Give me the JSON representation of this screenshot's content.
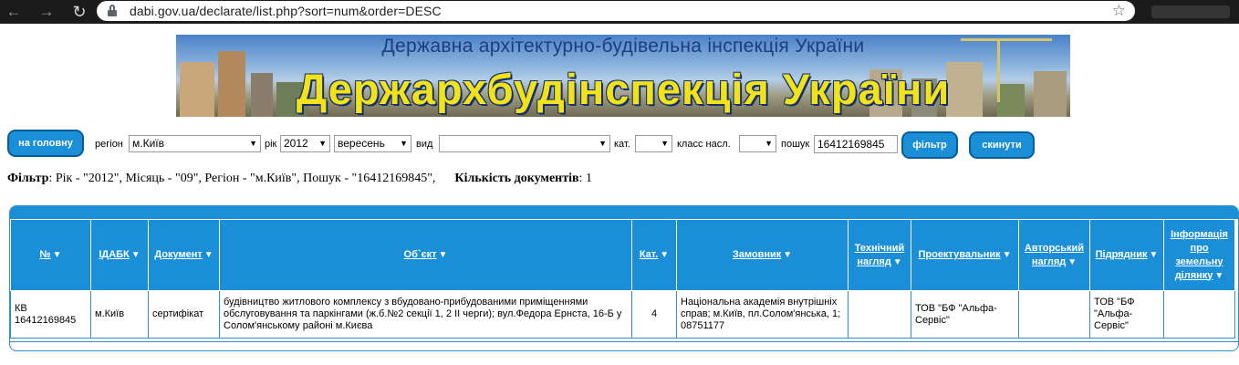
{
  "browser": {
    "url": "dabi.gov.ua/declarate/list.php?sort=num&order=DESC",
    "back_icon": "←",
    "forward_icon": "→",
    "reload_icon": "↻",
    "star_icon": "☆"
  },
  "banner": {
    "subtitle": "Державна архітектурно-будівельна інспекція України",
    "title": "Держархбудінспекція України"
  },
  "filters": {
    "home_button": "на головну",
    "region_label": "регіон",
    "region_value": "м.Київ",
    "year_label": "рік",
    "year_value": "2012",
    "month_value": "вересень",
    "type_label": "вид",
    "type_value": "",
    "category_label": "кат.",
    "category_value": "",
    "class_label": "класс насл.",
    "class_value": "",
    "search_label": "пошук",
    "search_value": "16412169845",
    "filter_button": "фільтр",
    "reset_button": "скинути"
  },
  "summary": {
    "filter_label": "Фільтр",
    "filter_text": ": Рік - \"2012\", Місяць - \"09\", Регіон - \"м.Київ\", Пошук - \"16412169845\",",
    "count_label": "Кількість документів",
    "count_value": ": 1"
  },
  "table": {
    "headers": {
      "num": "№",
      "idabk": "ІДАБК",
      "document": "Документ",
      "object": "Об`єкт",
      "cat": "Кат.",
      "customer": "Замовник",
      "tech_line1": "Технічний",
      "tech_line2": "нагляд",
      "designer": "Проектувальник",
      "author_line1": "Авторський",
      "author_line2": "нагляд",
      "contractor": "Підрядник",
      "land_line1": "Інформація",
      "land_line2": "про",
      "land_line3": "земельну",
      "land_line4": "ділянку"
    },
    "sort_icon": "▼",
    "rows": [
      {
        "num_line1": "КВ",
        "num_line2": "16412169845",
        "idabk": "м.Київ",
        "document": "сертифікат",
        "object": "будівництво житлового комплексу з вбудовано-прибудованими приміщеннями обслуговування та паркінгами (ж.б.№2 секції 1, 2 ІІ черги); вул.Федора Ернста, 16-Б у Солом'янському районі м.Києва",
        "cat": "4",
        "customer": "Національна академія внутрішніх справ; м.Київ, пл.Солом'янська, 1; 08751177",
        "tech": "",
        "designer": "ТОВ \"БФ \"Альфа-Сервіс\"",
        "author": "",
        "contractor": "ТОВ \"БФ \"Альфа-Сервіс\"",
        "land": ""
      }
    ]
  }
}
